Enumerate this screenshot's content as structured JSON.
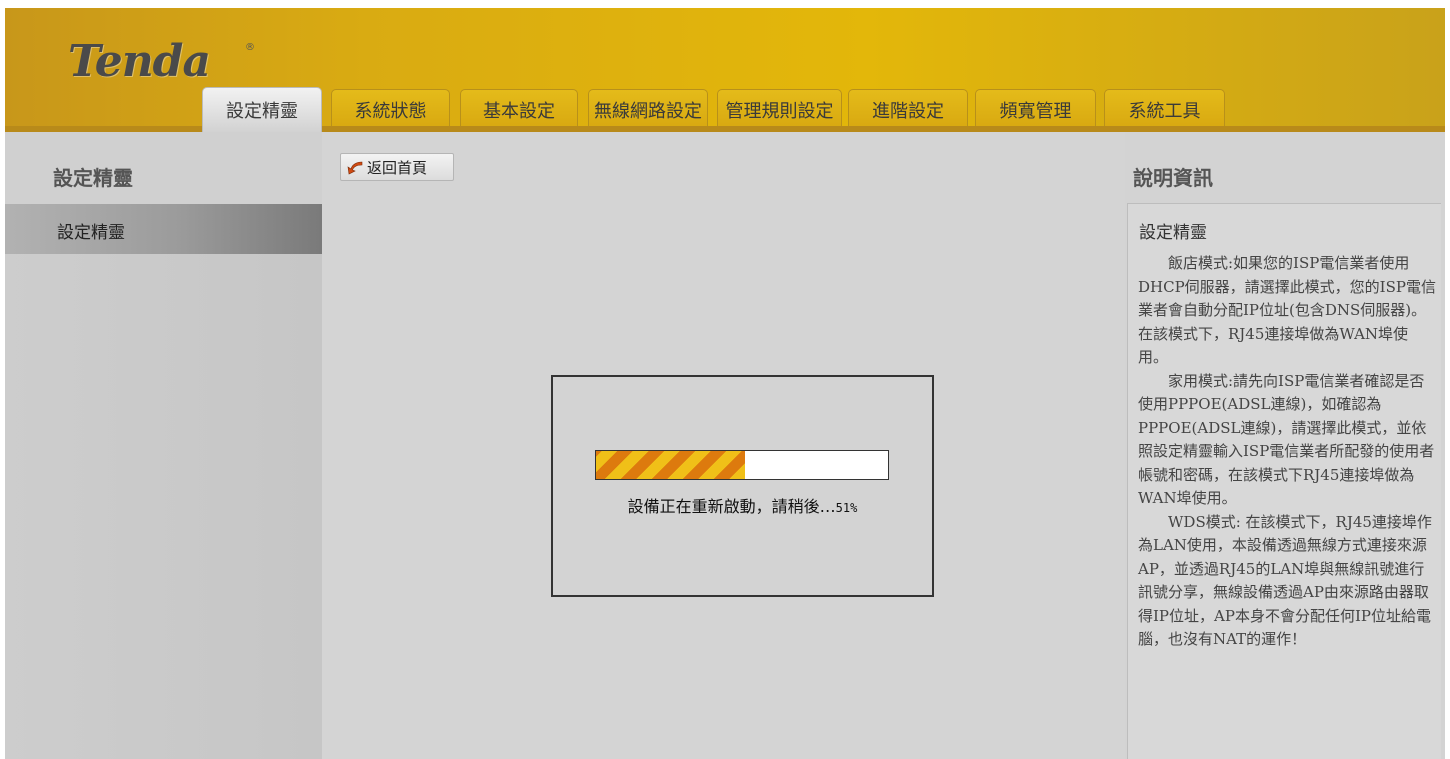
{
  "header": {
    "logo": "Tenda",
    "logo_mark": "®",
    "tabs": [
      {
        "label": "設定精靈",
        "active": true
      },
      {
        "label": "系統狀態",
        "active": false
      },
      {
        "label": "基本設定",
        "active": false
      },
      {
        "label": "無線網路設定",
        "active": false
      },
      {
        "label": "管理規則設定",
        "active": false
      },
      {
        "label": "進階設定",
        "active": false
      },
      {
        "label": "頻寬管理",
        "active": false
      },
      {
        "label": "系統工具",
        "active": false
      }
    ]
  },
  "sidebar": {
    "title": "設定精靈",
    "items": [
      {
        "label": "設定精靈",
        "selected": true
      }
    ]
  },
  "main": {
    "back_button": {
      "label": "返回首頁",
      "icon": "back-arrow-icon"
    },
    "progress": {
      "message": "設備正在重新啟動，請稍後…",
      "percent_text": "51%",
      "value": 0.51
    }
  },
  "help": {
    "title": "說明資訊",
    "heading": "設定精靈",
    "paragraphs": [
      "飯店模式:如果您的ISP電信業者使用DHCP伺服器，請選擇此模式，您的ISP電信業者會自動分配IP位址(包含DNS伺服器)。在該模式下，RJ45連接埠做為WAN埠使用。",
      "家用模式:請先向ISP電信業者確認是否使用PPPOE(ADSL連線)，如確認為PPPOE(ADSL連線)，請選擇此模式，並依照設定精靈輸入ISP電信業者所配發的使用者帳號和密碼，在該模式下RJ45連接埠做為WAN埠使用。",
      "WDS模式: 在該模式下，RJ45連接埠作為LAN使用，本設備透過無線方式連接來源AP，並透過RJ45的LAN埠與無線訊號進行訊號分享，無線設備透過AP由來源路由器取得IP位址，AP本身不會分配任何IP位址給電腦，也沒有NAT的運作！"
    ]
  },
  "colors": {
    "header_gold": "#e3b70a",
    "progress_stripe_orange": "#dd7a0e",
    "progress_stripe_yellow": "#f0c018",
    "panel_gray": "#d3d3d3"
  }
}
